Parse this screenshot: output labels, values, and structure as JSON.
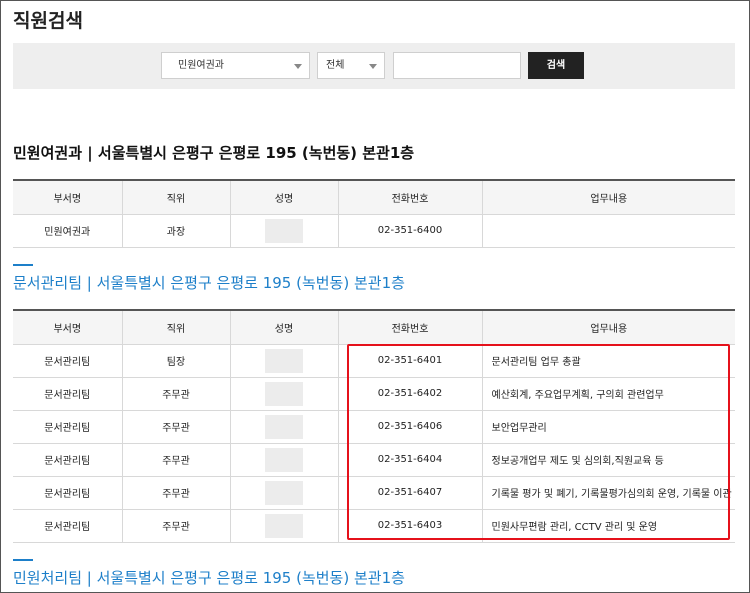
{
  "page": {
    "title": "직원검색"
  },
  "search": {
    "dept_select": "민원여권과",
    "scope_select": "전체",
    "keyword_value": "",
    "button_label": "검색"
  },
  "sections": [
    {
      "title": "민원여권과 | 서울특별시 은평구 은평로 195 (녹번동) 본관1층",
      "headers": [
        "부서명",
        "직위",
        "성명",
        "전화번호",
        "업무내용"
      ],
      "rows": [
        {
          "dept": "민원여권과",
          "position": "과장",
          "name": "",
          "phone": "02-351-6400",
          "duty": ""
        }
      ]
    },
    {
      "title": "문서관리팀 | 서울특별시 은평구 은평로 195 (녹번동) 본관1층",
      "headers": [
        "부서명",
        "직위",
        "성명",
        "전화번호",
        "업무내용"
      ],
      "rows": [
        {
          "dept": "문서관리팀",
          "position": "팀장",
          "name": "",
          "phone": "02-351-6401",
          "duty": "문서관리팀 업무 총괄"
        },
        {
          "dept": "문서관리팀",
          "position": "주무관",
          "name": "",
          "phone": "02-351-6402",
          "duty": "예산회계, 주요업무계획, 구의회 관련업무"
        },
        {
          "dept": "문서관리팀",
          "position": "주무관",
          "name": "",
          "phone": "02-351-6406",
          "duty": "보안업무관리"
        },
        {
          "dept": "문서관리팀",
          "position": "주무관",
          "name": "",
          "phone": "02-351-6404",
          "duty": "정보공개업무 제도 및 심의회,직원교육 등"
        },
        {
          "dept": "문서관리팀",
          "position": "주무관",
          "name": "",
          "phone": "02-351-6407",
          "duty": "기록물 평가 및 폐기, 기록물평가심의회 운영, 기록물 이관"
        },
        {
          "dept": "문서관리팀",
          "position": "주무관",
          "name": "",
          "phone": "02-351-6403",
          "duty": "민원사무편람 관리, CCTV 관리 및 운영"
        }
      ]
    },
    {
      "title": "민원처리팀 | 서울특별시 은평구 은평로 195 (녹번동) 본관1층"
    }
  ],
  "colors": {
    "accent_blue": "#1d7fc9",
    "highlight_red": "#e5111b",
    "button_dark": "#222222"
  }
}
